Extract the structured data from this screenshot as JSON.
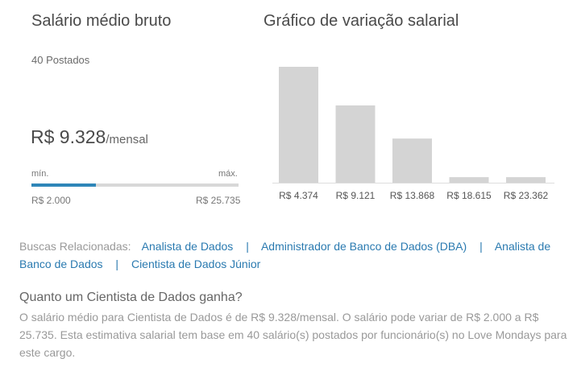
{
  "salary": {
    "title": "Salário médio bruto",
    "posted": "40 Postados",
    "amount": "R$ 9.328",
    "unit": "/mensal",
    "min_label": "mín.",
    "max_label": "máx.",
    "min_value": "R$ 2.000",
    "max_value": "R$ 25.735",
    "average_fraction": 0.31,
    "accent_color": "#2f86b8"
  },
  "chart_title": "Gráfico de variação salarial",
  "chart_data": {
    "type": "bar",
    "categories": [
      "R$ 4.374",
      "R$ 9.121",
      "R$ 13.868",
      "R$ 18.615",
      "R$ 23.362"
    ],
    "values": [
      21,
      14,
      8,
      1,
      1
    ],
    "bar_color": "#d4d4d4",
    "ylim": [
      0,
      21
    ],
    "grid": false
  },
  "related": {
    "lead": "Buscas Relacionadas:",
    "links": [
      "Analista de Dados",
      "Administrador de Banco de Dados (DBA)",
      "Analista de Banco de Dados",
      "Cientista de Dados Júnior"
    ],
    "separator": "|"
  },
  "faq": {
    "question": "Quanto um Cientista de Dados ganha?",
    "answer": "O salário médio para Cientista de Dados é de R$ 9.328/mensal. O salário pode variar de R$ 2.000 a R$ 25.735. Esta estimativa salarial tem base em 40 salário(s) postados por funcionário(s) no Love Mondays para este cargo."
  }
}
